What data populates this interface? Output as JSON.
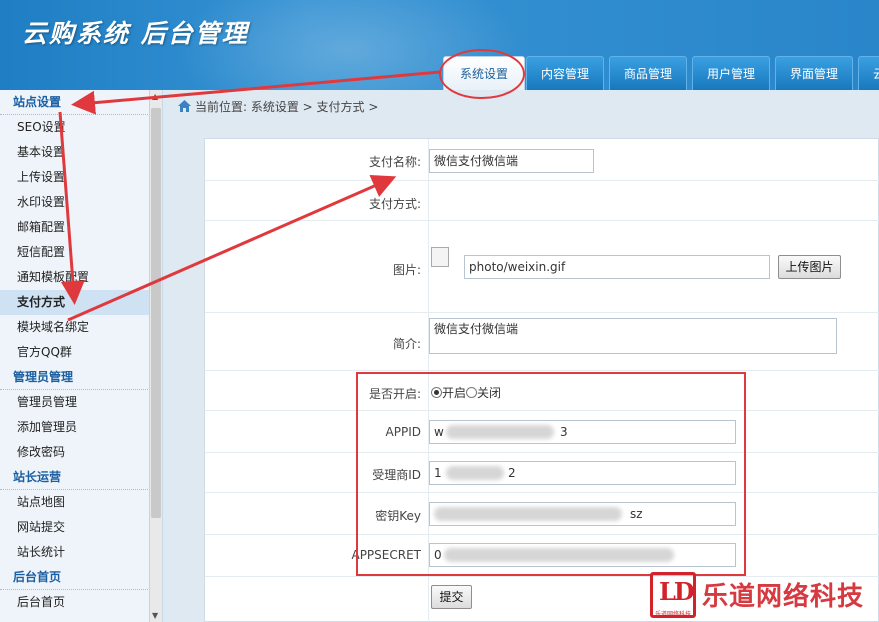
{
  "app": {
    "title": "云购系统 后台管理"
  },
  "top_nav": {
    "tabs": [
      {
        "label": "系统设置",
        "active": true
      },
      {
        "label": "内容管理",
        "active": false
      },
      {
        "label": "商品管理",
        "active": false
      },
      {
        "label": "用户管理",
        "active": false
      },
      {
        "label": "界面管理",
        "active": false
      },
      {
        "label": "云",
        "active": false
      }
    ]
  },
  "sidebar": {
    "groups": [
      {
        "title": "站点设置",
        "items": [
          "SEO设置",
          "基本设置",
          "上传设置",
          "水印设置",
          "邮箱配置",
          "短信配置",
          "通知模板配置",
          "支付方式",
          "模块域名绑定",
          "官方QQ群"
        ]
      },
      {
        "title": "管理员管理",
        "items": [
          "管理员管理",
          "添加管理员",
          "修改密码"
        ]
      },
      {
        "title": "站长运营",
        "items": [
          "站点地图",
          "网站提交",
          "站长统计"
        ]
      },
      {
        "title": "后台首页",
        "items": [
          "后台首页"
        ]
      }
    ],
    "active_item": "支付方式"
  },
  "breadcrumb": {
    "text": "当前位置: 系统设置 > 支付方式 >"
  },
  "form": {
    "pay_name": {
      "label": "支付名称:",
      "value": "微信支付微信端"
    },
    "pay_method": {
      "label": "支付方式:"
    },
    "image": {
      "label": "图片:",
      "value": "photo/weixin.gif",
      "upload_button": "上传图片"
    },
    "intro": {
      "label": "简介:",
      "value": "微信支付微信端"
    },
    "enabled": {
      "label": "是否开启:",
      "on": "开启",
      "off": "关闭",
      "selected": "开启"
    },
    "appid": {
      "label": "APPID",
      "value_prefix": "w",
      "value_suffix": "3"
    },
    "merchant_id": {
      "label": "受理商ID",
      "value_prefix": "1",
      "value_suffix": "2"
    },
    "key": {
      "label": "密钥Key",
      "value_suffix": "sz"
    },
    "appsecret": {
      "label": "APPSECRET",
      "value_prefix": "0"
    },
    "submit_button": "提交"
  },
  "watermark": {
    "logo": "LD",
    "logo_sub": "乐道网络科技",
    "text": "乐道网络科技"
  },
  "colors": {
    "header": "#2a86c9",
    "annotation": "#e0393d",
    "sidebar_group": "#1a5fa3"
  }
}
